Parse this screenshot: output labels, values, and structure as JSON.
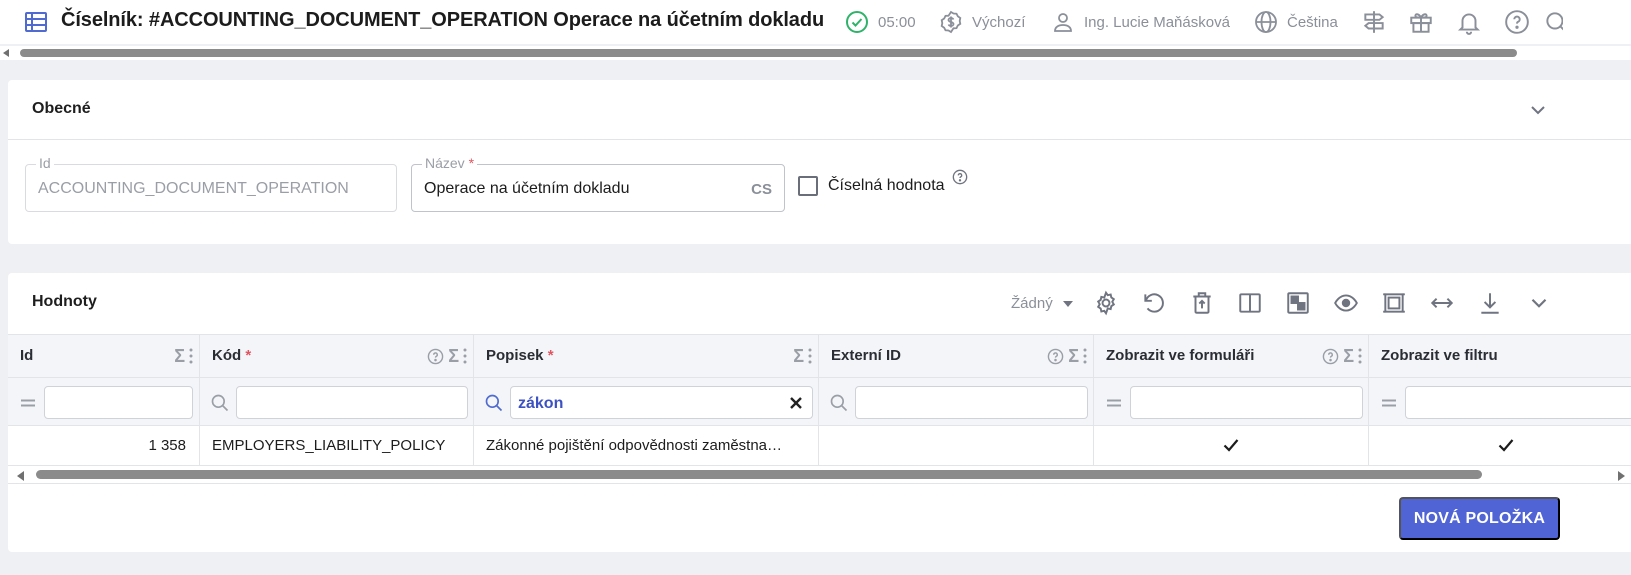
{
  "header": {
    "title": "Číselník: #ACCOUNTING_DOCUMENT_OPERATION Operace na účetním dokladu",
    "session_time": "05:00",
    "currency_mode": "Výchozí",
    "user_name": "Ing. Lucie Maňásková",
    "language": "Čeština",
    "icons": [
      "table-icon",
      "check-circle-icon",
      "dollar-circle-icon",
      "user-icon",
      "globe-icon",
      "signpost-icon",
      "gift-icon",
      "bell-icon",
      "help-icon",
      "search-icon"
    ]
  },
  "general": {
    "title": "Obecné",
    "id_field": {
      "label": "Id",
      "value": "ACCOUNTING_DOCUMENT_OPERATION"
    },
    "name_field": {
      "label": "Název",
      "required_mark": "*",
      "value": "Operace na účetním dokladu",
      "lang": "CS"
    },
    "numeric_checkbox": {
      "label": "Číselná hodnota",
      "checked": false
    }
  },
  "values": {
    "title": "Hodnoty",
    "view_select": "Žádný",
    "toolbar_icons": [
      "settings-icon",
      "undo-icon",
      "delete-icon",
      "columns-icon",
      "layout-icon",
      "eye-icon",
      "frame-icon",
      "expand-width-icon",
      "download-icon",
      "chevron-down-icon"
    ],
    "columns": [
      {
        "label": "Id",
        "required": false
      },
      {
        "label": "Kód",
        "required": true
      },
      {
        "label": "Popisek",
        "required": true
      },
      {
        "label": "Externí ID",
        "required": false
      },
      {
        "label": "Zobrazit ve formuláři",
        "required": false
      },
      {
        "label": "Zobrazit ve filtru",
        "required": false
      }
    ],
    "required_mark": "*",
    "sigma": "Σ",
    "filters": {
      "popisek": "zákon"
    },
    "rows": [
      {
        "id": "1 358",
        "kod": "EMPLOYERS_LIABILITY_POLICY",
        "popisek": "Zákonné pojištění odpovědnosti zaměstna…",
        "externi_id": "",
        "show_in_form": true,
        "show_in_filter": true
      }
    ],
    "new_button": "NOVÁ POLOŽKA"
  },
  "colors": {
    "accent": "#5164d6",
    "success": "#2fb36b",
    "required": "#e05561"
  }
}
